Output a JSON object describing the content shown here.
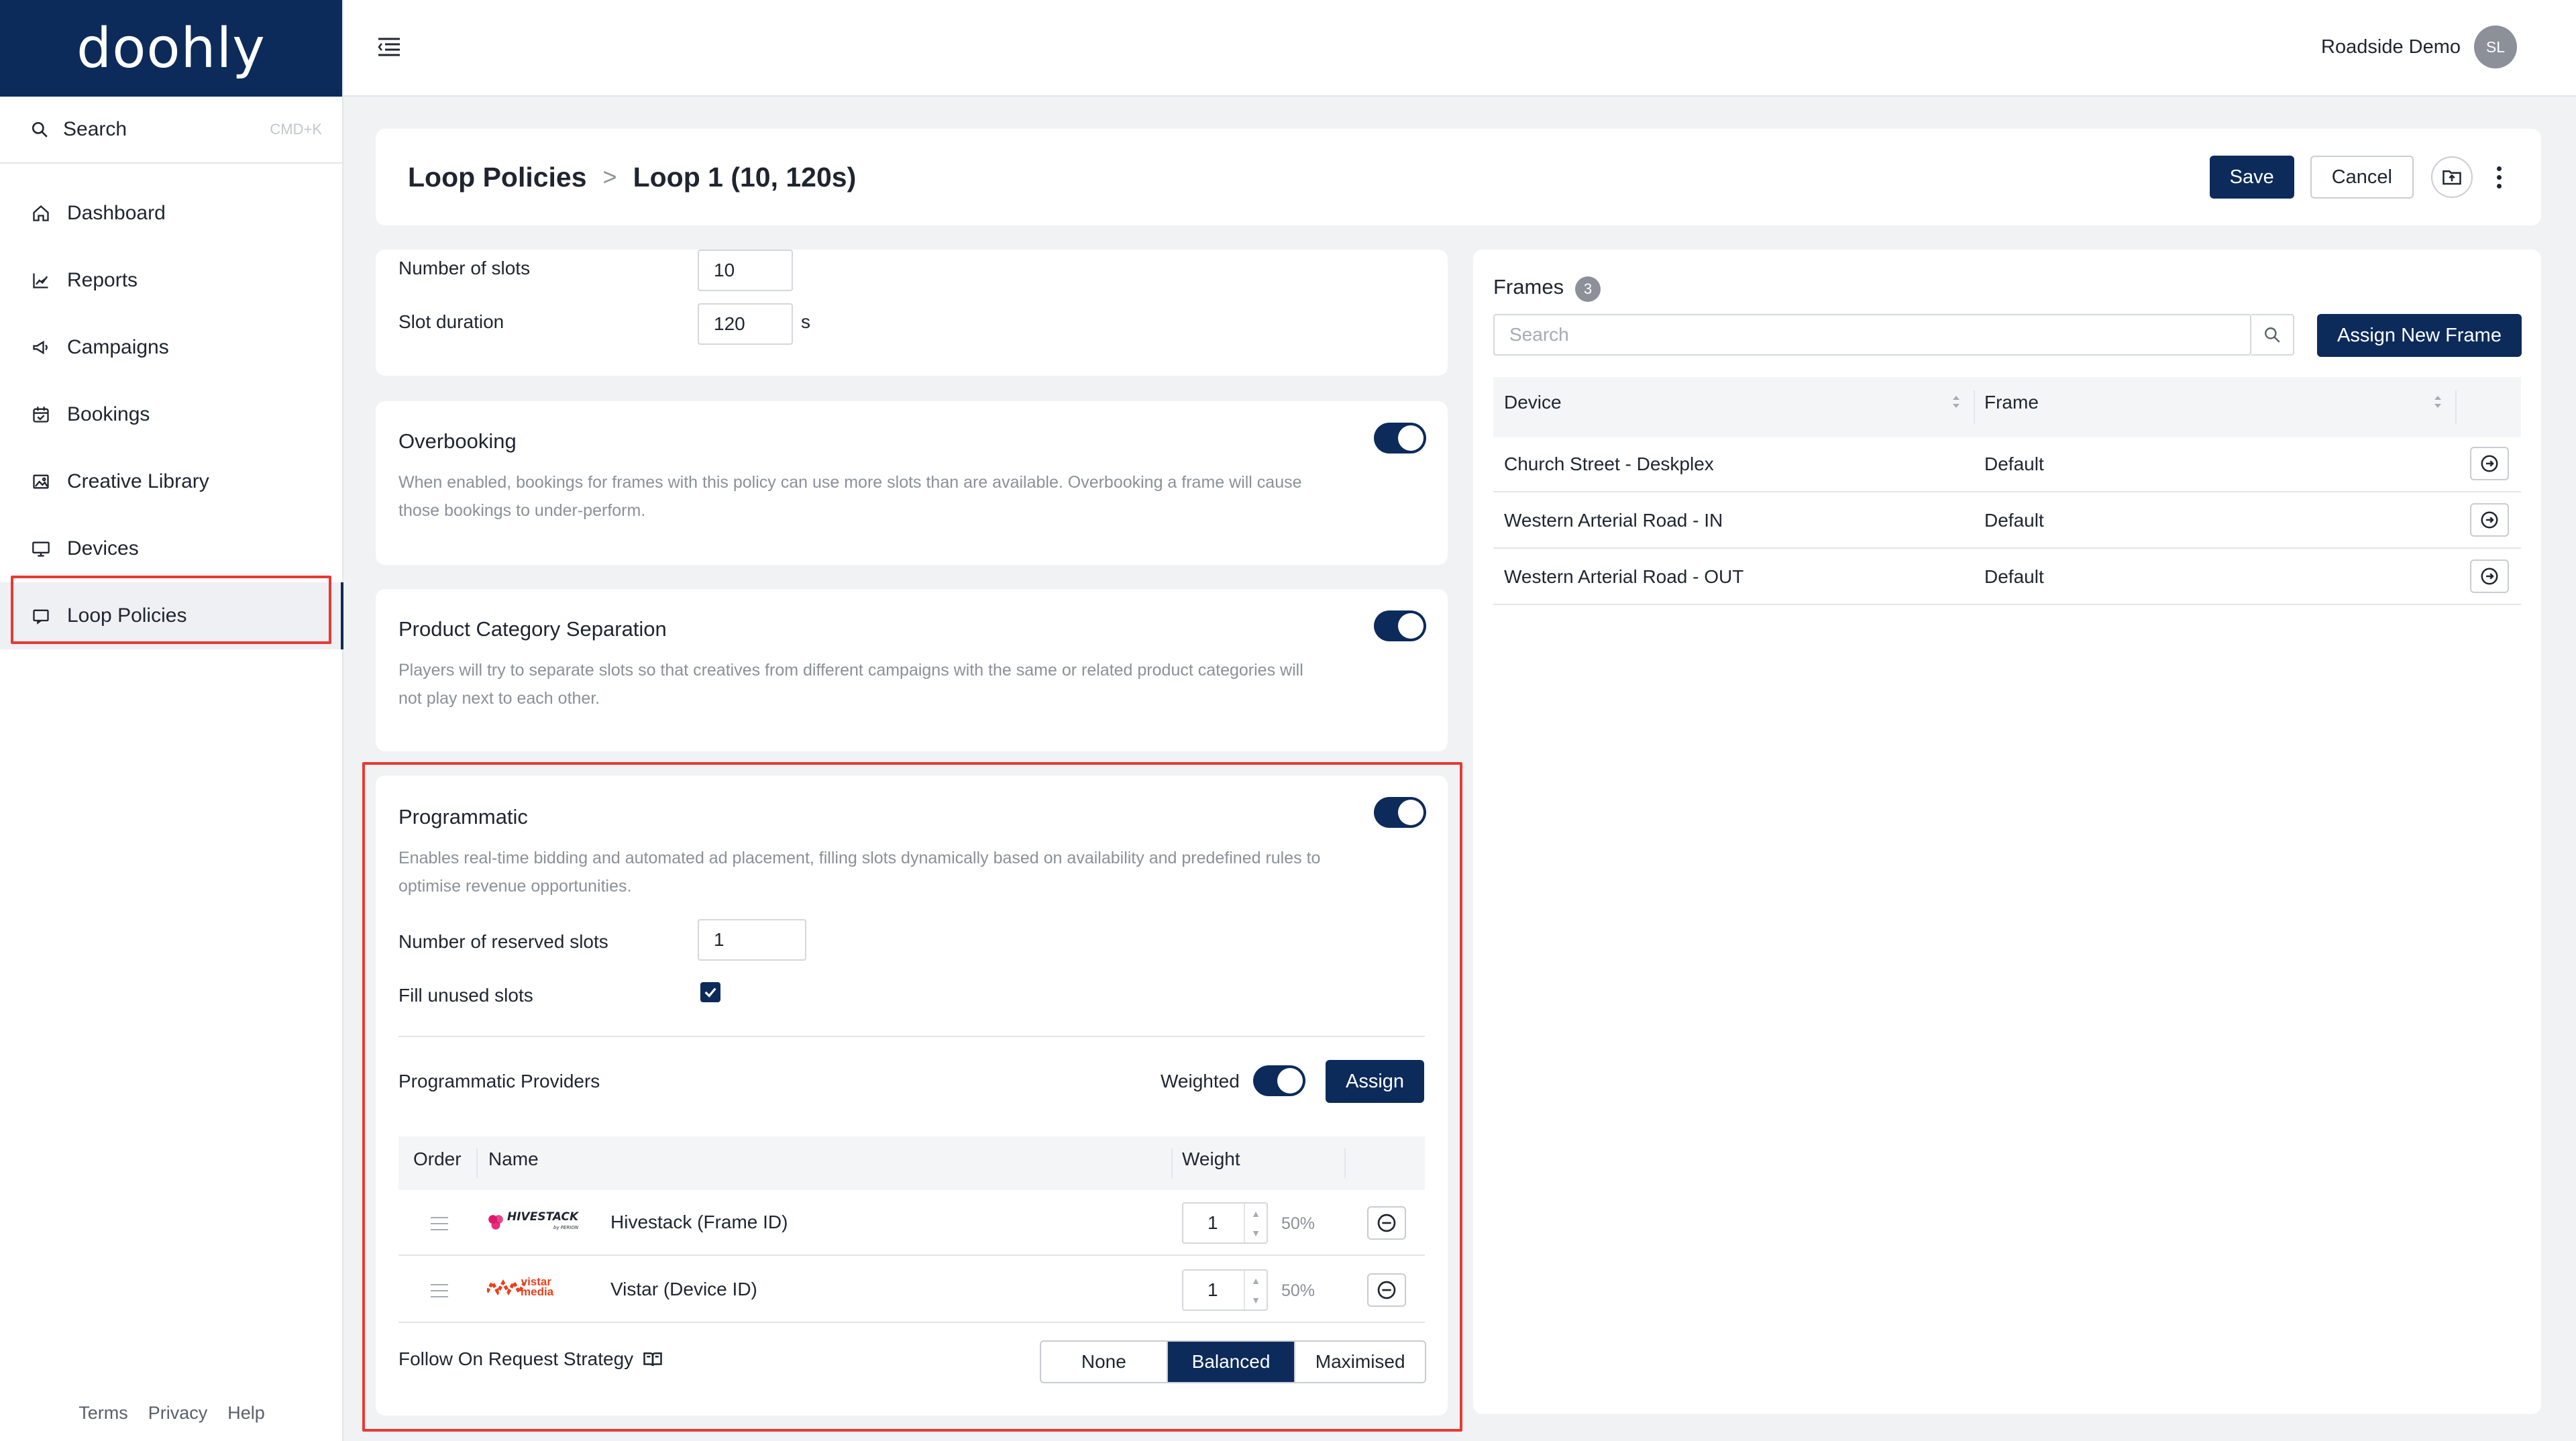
{
  "app": {
    "logo": "doohly"
  },
  "sidebar": {
    "search_label": "Search",
    "search_shortcut": "CMD+K",
    "items": [
      {
        "label": "Dashboard",
        "icon": "home-icon"
      },
      {
        "label": "Reports",
        "icon": "chart-icon"
      },
      {
        "label": "Campaigns",
        "icon": "megaphone-icon"
      },
      {
        "label": "Bookings",
        "icon": "calendar-icon"
      },
      {
        "label": "Creative Library",
        "icon": "image-icon"
      },
      {
        "label": "Devices",
        "icon": "monitor-icon"
      },
      {
        "label": "Loop Policies",
        "icon": "loop-icon",
        "active": true
      }
    ],
    "footer": {
      "terms": "Terms",
      "privacy": "Privacy",
      "help": "Help"
    }
  },
  "topbar": {
    "user_name": "Roadside Demo",
    "avatar_initials": "SL"
  },
  "header": {
    "breadcrumb_root": "Loop Policies",
    "breadcrumb_sep": ">",
    "breadcrumb_current": "Loop 1 (10, 120s)",
    "save_label": "Save",
    "cancel_label": "Cancel"
  },
  "slots": {
    "number_label": "Number of slots",
    "number_value": "10",
    "duration_label": "Slot duration",
    "duration_value": "120",
    "duration_unit": "s"
  },
  "overbooking": {
    "title": "Overbooking",
    "enabled": true,
    "desc_line1": "When enabled, bookings for frames with this policy can use more slots than are available. Overbooking a frame will cause",
    "desc_line2": "those bookings to under-perform."
  },
  "category_separation": {
    "title": "Product Category Separation",
    "enabled": true,
    "desc_line1": "Players will try to separate slots so that creatives from different campaigns with the same or related product categories will",
    "desc_line2": "not play next to each other."
  },
  "programmatic": {
    "title": "Programmatic",
    "enabled": true,
    "desc_line1": "Enables real-time bidding and automated ad placement, filling slots dynamically based on availability and predefined rules to",
    "desc_line2": "optimise revenue opportunities.",
    "reserved_label": "Number of reserved slots",
    "reserved_value": "1",
    "fill_unused_label": "Fill unused slots",
    "fill_unused_checked": true,
    "providers_label": "Programmatic Providers",
    "weighted_label": "Weighted",
    "weighted_enabled": true,
    "assign_label": "Assign",
    "table_headers": {
      "order": "Order",
      "name": "Name",
      "weight": "Weight"
    },
    "providers": [
      {
        "logo_text": "HIVESTACK",
        "logo_sub": "by PERION",
        "name": "Hivestack (Frame ID)",
        "weight": "1",
        "percent": "50%"
      },
      {
        "logo_text": "vistar media",
        "name": "Vistar (Device ID)",
        "weight": "1",
        "percent": "50%"
      }
    ],
    "strategy_label": "Follow On Request Strategy",
    "strategy_options": [
      "None",
      "Balanced",
      "Maximised"
    ],
    "strategy_selected": "Balanced"
  },
  "frames": {
    "title": "Frames",
    "count": "3",
    "search_placeholder": "Search",
    "assign_new_label": "Assign New Frame",
    "headers": {
      "device": "Device",
      "frame": "Frame"
    },
    "rows": [
      {
        "device": "Church Street - Deskplex",
        "frame": "Default"
      },
      {
        "device": "Western Arterial Road - IN",
        "frame": "Default"
      },
      {
        "device": "Western Arterial Road - OUT",
        "frame": "Default"
      }
    ]
  },
  "colors": {
    "brand": "#0c2b5b",
    "highlight": "#e53a35",
    "hivestack": "#e2186f",
    "vistar": "#e8401c"
  }
}
